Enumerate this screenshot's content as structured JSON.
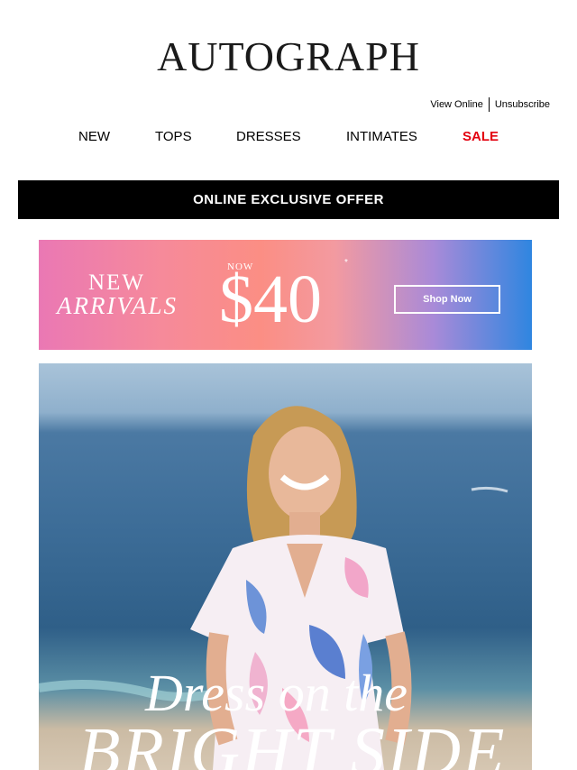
{
  "brand": {
    "logo_text": "AUTOGRAPH"
  },
  "utility_links": {
    "view_online": "View Online",
    "unsubscribe": "Unsubscribe"
  },
  "nav": {
    "items": [
      {
        "label": "NEW"
      },
      {
        "label": "TOPS"
      },
      {
        "label": "DRESSES"
      },
      {
        "label": "INTIMATES"
      },
      {
        "label": "SALE"
      }
    ],
    "sale_color": "#e3000f"
  },
  "offer_bar": {
    "text": "ONLINE EXCLUSIVE OFFER"
  },
  "promo_banner": {
    "headline_line1": "NEW",
    "headline_line2": "ARRIVALS",
    "price_prefix": "NOW",
    "price": "$40",
    "price_footnote": "*",
    "button_label": "Shop Now"
  },
  "hero": {
    "script_text": "Dress on the",
    "bold_text": "BRIGHT SIDE"
  }
}
